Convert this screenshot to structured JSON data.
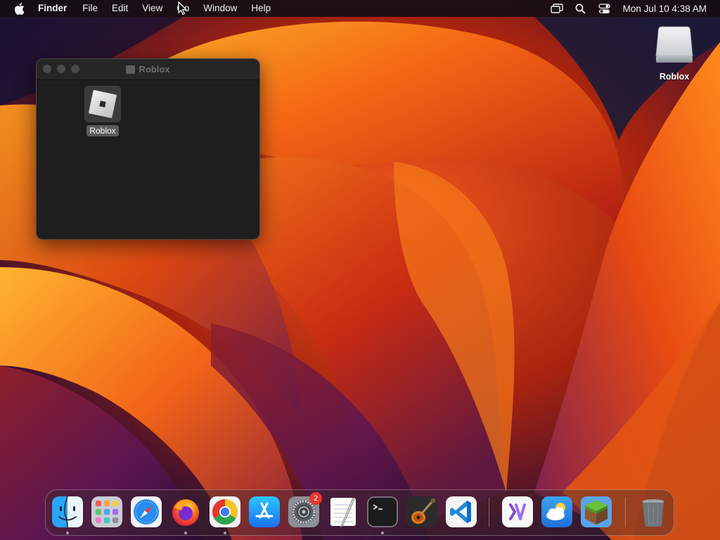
{
  "menubar": {
    "app_name": "Finder",
    "items": [
      "File",
      "Edit",
      "View",
      "Go",
      "Window",
      "Help"
    ],
    "clock": "Mon Jul 10  4:38 AM",
    "status_icons": [
      "screen-mirroring-icon",
      "spotlight-search-icon",
      "control-center-icon"
    ]
  },
  "finder_window": {
    "title": "Roblox",
    "files": [
      {
        "label": "Roblox",
        "icon": "roblox-app-icon",
        "selected": true
      }
    ]
  },
  "desktop": {
    "items": [
      {
        "label": "Roblox",
        "icon": "external-disk-icon"
      }
    ]
  },
  "dock": {
    "apps": [
      {
        "name": "Finder",
        "icon": "finder-icon",
        "running": true
      },
      {
        "name": "Launchpad",
        "icon": "launchpad-icon",
        "running": false
      },
      {
        "name": "Safari",
        "icon": "safari-icon",
        "running": false
      },
      {
        "name": "Firefox",
        "icon": "firefox-icon",
        "running": true
      },
      {
        "name": "Google Chrome",
        "icon": "chrome-icon",
        "running": true
      },
      {
        "name": "App Store",
        "icon": "app-store-icon",
        "running": false
      },
      {
        "name": "System Settings",
        "icon": "system-settings-icon",
        "running": false,
        "badge": "2"
      },
      {
        "name": "TextEdit",
        "icon": "textedit-icon",
        "running": false
      },
      {
        "name": "Terminal",
        "icon": "terminal-icon",
        "running": true
      },
      {
        "name": "GarageBand",
        "icon": "garageband-icon",
        "running": false
      },
      {
        "name": "Visual Studio Code",
        "icon": "vscode-icon",
        "running": false
      },
      {
        "name": "Visual Studio",
        "icon": "visual-studio-icon",
        "running": false
      },
      {
        "name": "Weather",
        "icon": "weather-icon",
        "running": false
      },
      {
        "name": "Minecraft",
        "icon": "minecraft-icon",
        "running": false
      },
      {
        "name": "Trash",
        "icon": "trash-icon",
        "running": false
      }
    ]
  },
  "colors": {
    "accent": "#0a84ff",
    "badge": "#e8352c"
  }
}
